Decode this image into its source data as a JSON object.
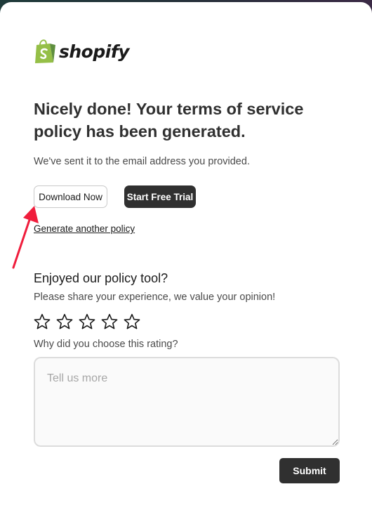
{
  "brand": {
    "name": "shopify",
    "logo_icon": "shopping-bag-logo-icon",
    "color": "#95bf47"
  },
  "heading": {
    "title": "Nicely done! Your terms of service policy has been generated.",
    "subtitle": "We've sent it to the email address you provided."
  },
  "actions": {
    "download_label": "Download Now",
    "trial_label": "Start Free Trial",
    "generate_another_label": "Generate another policy"
  },
  "annotation": {
    "icon": "red-arrow-icon",
    "color": "#f01d3c"
  },
  "feedback": {
    "title": "Enjoyed our policy tool?",
    "subtitle": "Please share your experience, we value your opinion!",
    "rating": {
      "value": 0,
      "max": 5,
      "icon": "star-outline-icon"
    },
    "question": "Why did you choose this rating?",
    "comment": {
      "value": "",
      "placeholder": "Tell us more"
    },
    "submit_label": "Submit"
  }
}
